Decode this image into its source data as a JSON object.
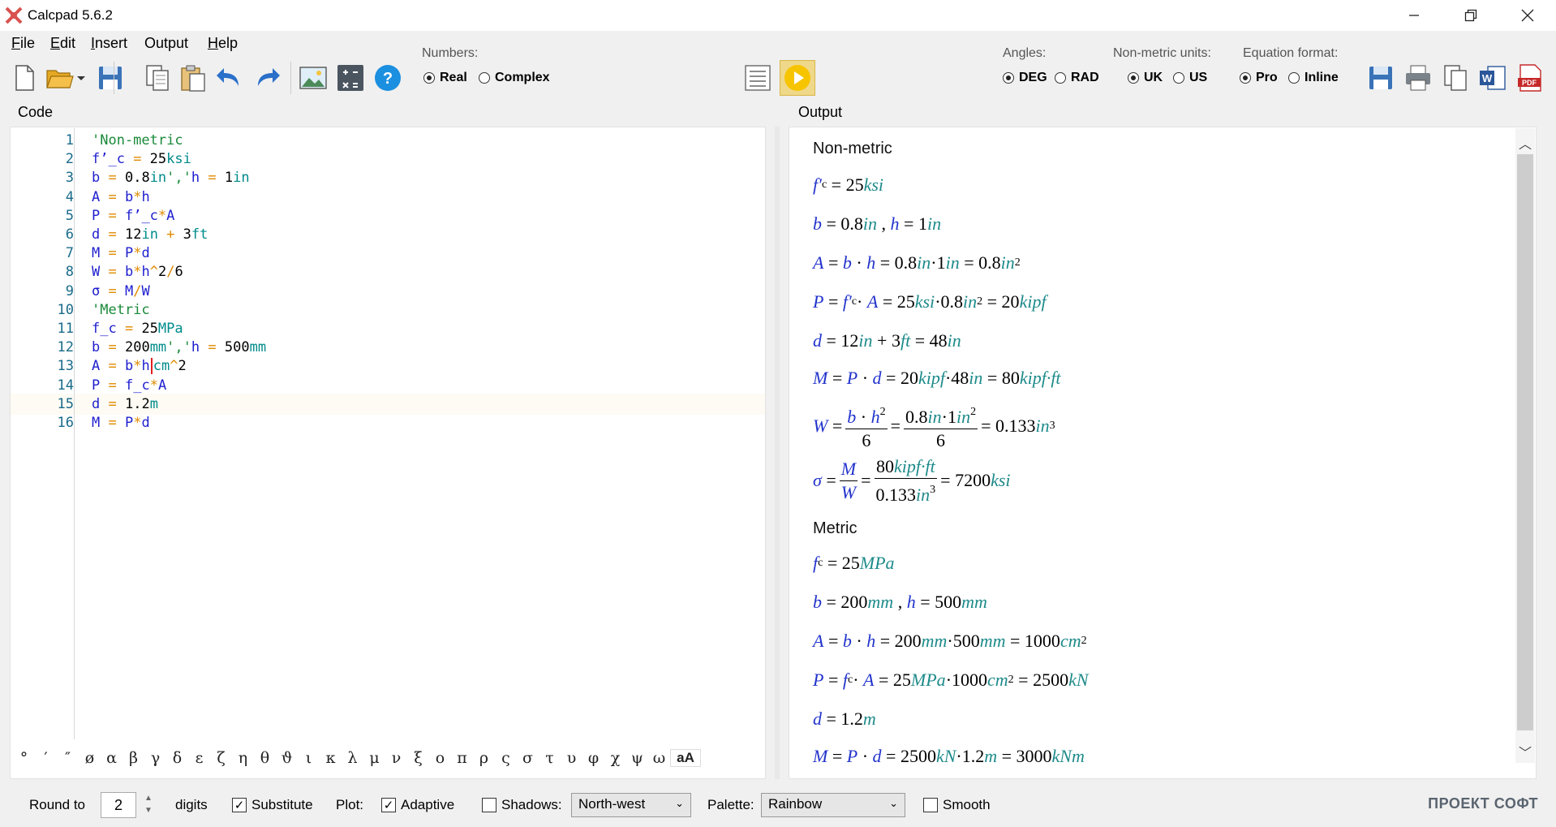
{
  "window": {
    "title": "Calcpad 5.6.2",
    "minimize_icon": "minimize-icon",
    "maximize_icon": "restore-icon",
    "close_icon": "close-icon"
  },
  "menu": [
    "File",
    "Edit",
    "Insert",
    "Output",
    "Help"
  ],
  "toolbar": {
    "numbers_label": "Numbers:",
    "numbers_options": [
      "Real",
      "Complex"
    ],
    "numbers_selected": "Real",
    "angles_label": "Angles:",
    "angles_options": [
      "DEG",
      "RAD"
    ],
    "angles_selected": "DEG",
    "units_label": "Non-metric units:",
    "units_options": [
      "UK",
      "US"
    ],
    "units_selected": "UK",
    "equation_label": "Equation format:",
    "equation_options": [
      "Pro",
      "Inline"
    ],
    "equation_selected": "Pro",
    "icons": [
      "new-file-icon",
      "open-folder-icon",
      "save-icon",
      "copy-icon",
      "paste-icon",
      "undo-icon",
      "redo-icon",
      "image-icon",
      "calculator-icon",
      "help-icon",
      "toggle-view-icon",
      "run-icon",
      "save-output-icon",
      "print-icon",
      "copy-output-icon",
      "word-icon",
      "pdf-icon"
    ],
    "accent_color": "#f7c400"
  },
  "code_panel": {
    "label": "Code",
    "lines": [
      {
        "n": "1",
        "text": "'Non-metric"
      },
      {
        "n": "2",
        "text": "f’_c = 25ksi"
      },
      {
        "n": "3",
        "text": "b = 0.8in','h = 1in"
      },
      {
        "n": "4",
        "text": "A = b*h"
      },
      {
        "n": "5",
        "text": "P = f’_c*A"
      },
      {
        "n": "6",
        "text": "d = 12in + 3ft"
      },
      {
        "n": "7",
        "text": "M = P*d"
      },
      {
        "n": "8",
        "text": "W = b*h^2/6"
      },
      {
        "n": "9",
        "text": "σ = M/W"
      },
      {
        "n": "10",
        "text": "'Metric"
      },
      {
        "n": "11",
        "text": "f_c = 25MPa"
      },
      {
        "n": "12",
        "text": "b = 200mm','h = 500mm"
      },
      {
        "n": "13",
        "text": "A = b*h|cm^2"
      },
      {
        "n": "14",
        "text": "P = f_c*A"
      },
      {
        "n": "15",
        "text": "d = 1.2m"
      },
      {
        "n": "16",
        "text": "M = P*d"
      }
    ],
    "greek": [
      "°",
      "′",
      "″",
      "ø",
      "α",
      "β",
      "γ",
      "δ",
      "ε",
      "ζ",
      "η",
      "θ",
      "ϑ",
      "ι",
      "κ",
      "λ",
      "μ",
      "ν",
      "ξ",
      "ο",
      "π",
      "ρ",
      "ς",
      "σ",
      "τ",
      "υ",
      "φ",
      "χ",
      "ψ",
      "ω",
      "aA"
    ]
  },
  "output_panel": {
    "label": "Output",
    "heading_nonmetric": "Non-metric",
    "heading_metric": "Metric"
  },
  "statusbar": {
    "round_label": "Round to",
    "round_value": "2",
    "digits_label": "digits",
    "substitute_label": "Substitute",
    "substitute_checked": true,
    "plot_label": "Plot:",
    "adaptive_label": "Adaptive",
    "adaptive_checked": true,
    "shadows_label": "Shadows:",
    "shadows_checked": false,
    "shadows_value": "North-west",
    "palette_label": "Palette:",
    "palette_value": "Rainbow",
    "smooth_label": "Smooth",
    "smooth_checked": false,
    "brand": "ПРОЕКТ СОФТ"
  }
}
